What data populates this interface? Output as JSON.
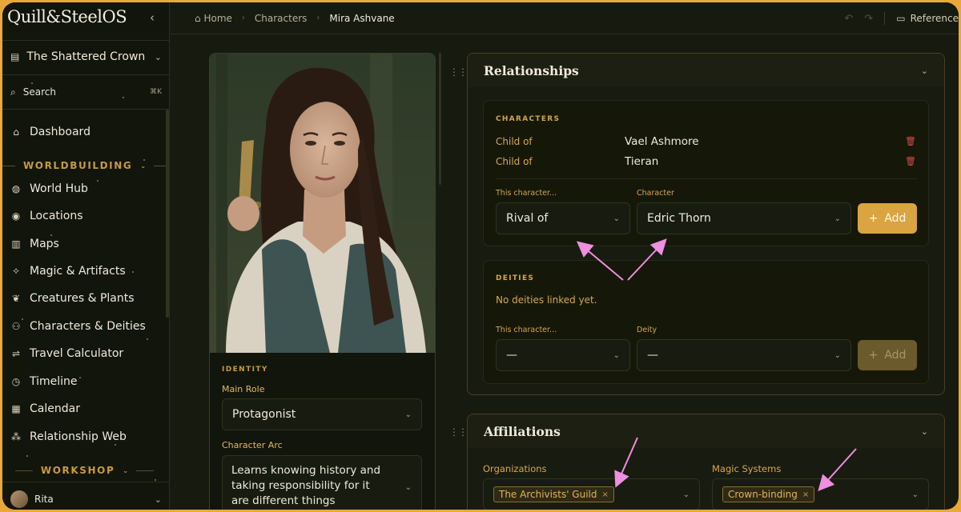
{
  "app": {
    "logo": "Quill&SteelOS"
  },
  "sidebar": {
    "project": "The Shattered Crown",
    "search_label": "Search",
    "search_shortcut": "⌘K",
    "items_top": [
      {
        "label": "Dashboard",
        "icon": "home-icon"
      }
    ],
    "section_worldbuilding": "WORLDBUILDING",
    "worldbuilding": [
      {
        "label": "World Hub",
        "icon": "globe-icon"
      },
      {
        "label": "Locations",
        "icon": "map-pin-icon"
      },
      {
        "label": "Maps",
        "icon": "map-icon"
      },
      {
        "label": "Magic & Artifacts",
        "icon": "wand-icon"
      },
      {
        "label": "Creatures & Plants",
        "icon": "leaf-icon"
      },
      {
        "label": "Characters & Deities",
        "icon": "users-icon"
      },
      {
        "label": "Travel Calculator",
        "icon": "route-icon"
      },
      {
        "label": "Timeline",
        "icon": "clock-icon"
      },
      {
        "label": "Calendar",
        "icon": "calendar-icon"
      },
      {
        "label": "Relationship Web",
        "icon": "network-icon"
      }
    ],
    "section_workshop": "WORKSHOP",
    "user": "Rita"
  },
  "breadcrumb": {
    "home": "Home",
    "section": "Characters",
    "current": "Mira Ashvane"
  },
  "topbar": {
    "reference": "Reference"
  },
  "character": {
    "identity_heading": "IDENTITY",
    "main_role_label": "Main Role",
    "main_role_value": "Protagonist",
    "arc_label": "Character Arc",
    "arc_value": "Learns knowing history and taking responsibility for it are different things"
  },
  "relationships": {
    "title": "Relationships",
    "characters_heading": "CHARACTERS",
    "links": [
      {
        "type": "Child of",
        "name": "Vael Ashmore"
      },
      {
        "type": "Child of",
        "name": "Tieran"
      }
    ],
    "form_type_label": "This character...",
    "form_type_value": "Rival of",
    "form_target_label": "Character",
    "form_target_value": "Edric Thorn",
    "add_label": "Add",
    "deities_heading": "DEITIES",
    "deities_empty": "No deities linked yet.",
    "deity_type_label": "This character...",
    "deity_type_value": "—",
    "deity_target_label": "Deity",
    "deity_target_value": "—",
    "deity_add_label": "Add"
  },
  "affiliations": {
    "title": "Affiliations",
    "org_label": "Organizations",
    "org_tags": [
      "The Archivists' Guild"
    ],
    "magic_label": "Magic Systems",
    "magic_tags": [
      "Crown-binding"
    ]
  },
  "colors": {
    "accent": "#d9a441",
    "annotation": "#ee8fe0",
    "danger": "#d84a4a"
  }
}
